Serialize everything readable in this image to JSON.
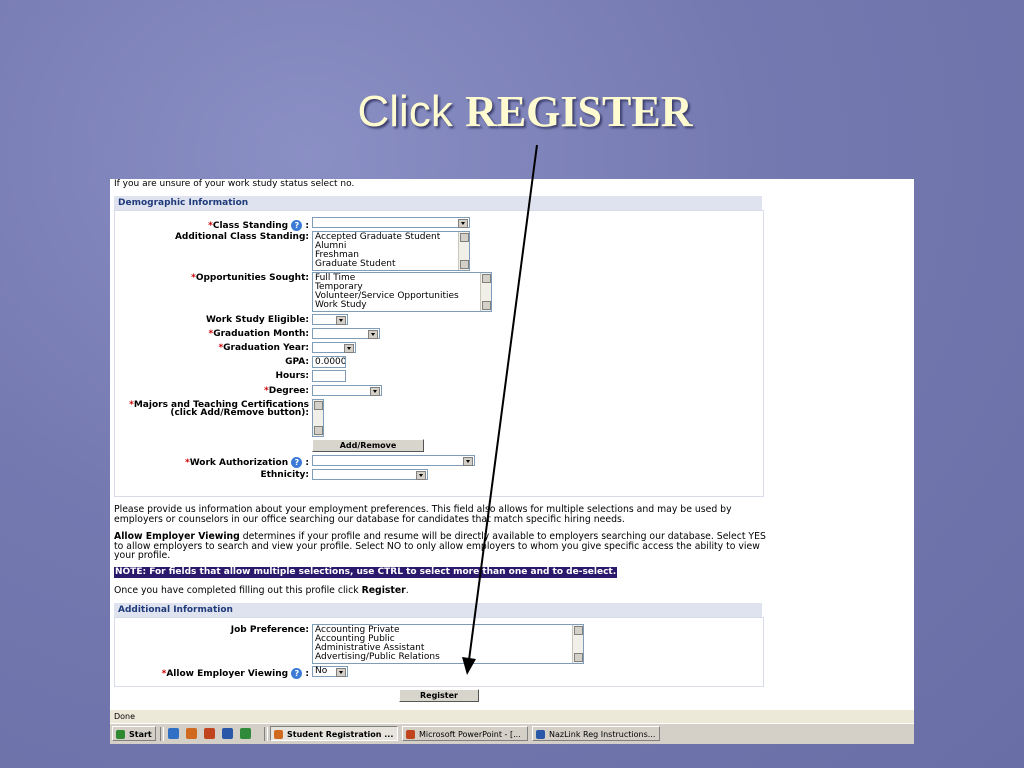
{
  "slide": {
    "title_plain": "Click",
    "title_bold": "REGISTER"
  },
  "form": {
    "intro_text": "If you are unsure of your work study status select no.",
    "demographic_header": "Demographic Information",
    "class_standing_label": "Class Standing",
    "class_standing_value": "",
    "additional_class_standing_label": "Additional Class Standing:",
    "additional_class_standing_options": [
      "Accepted Graduate Student",
      "Alumni",
      "Freshman",
      "Graduate Student"
    ],
    "opportunities_label": "Opportunities Sought:",
    "opportunities_options": [
      "Full Time",
      "Temporary",
      "Volunteer/Service Opportunities",
      "Work Study"
    ],
    "work_study_label": "Work Study Eligible:",
    "work_study_value": "",
    "grad_month_label": "Graduation Month:",
    "grad_month_value": "",
    "grad_year_label": "Graduation Year:",
    "grad_year_value": "",
    "gpa_label": "GPA:",
    "gpa_value": "0.0000",
    "hours_label": "Hours:",
    "hours_value": "",
    "degree_label": "Degree:",
    "degree_value": "",
    "majors_label_1": "Majors and Teaching Certifications",
    "majors_label_2": "(click Add/Remove button):",
    "add_remove_label": "Add/Remove",
    "work_auth_label": "Work Authorization",
    "work_auth_value": "",
    "ethnicity_label": "Ethnicity:",
    "ethnicity_value": "",
    "para1": "Please provide us information about your employment preferences. This field also allows for multiple selections and may be used by employers or counselors in our office searching our database for candidates that match specific hiring needs.",
    "para2_bold": "Allow Employer Viewing",
    "para2_rest": " determines if your profile and resume will be directly available to employers searching our database. Select YES to allow employers to search and view your profile. Select NO to only allow employers to whom you give specific access the ability to view your profile.",
    "note": "NOTE: For fields that allow multiple selections, use CTRL to select more than one and to de-select.",
    "once_text_pre": "Once you have completed filling out this profile click ",
    "once_text_bold": "Register",
    "once_text_post": ".",
    "additional_header": "Additional Information",
    "job_pref_label": "Job Preference:",
    "job_pref_options": [
      "Accounting Private",
      "Accounting Public",
      "Administrative Assistant",
      "Advertising/Public Relations"
    ],
    "allow_viewing_label": "Allow Employer Viewing",
    "allow_viewing_value": "No",
    "register_label": "Register",
    "required_mark": "*",
    "help_glyph": "?"
  },
  "status_bar": {
    "text": "Done"
  },
  "taskbar": {
    "start_label": "Start",
    "buttons": [
      "Student Registration ...",
      "Microsoft PowerPoint - [...",
      "NazLink Reg Instructions..."
    ]
  },
  "colors": {
    "slide_bg": "#7479b0",
    "title_text": "#fffbd0",
    "section_header_text": "#1f3b7a",
    "note_bg": "#2b1a6b",
    "required": "#cc0000"
  }
}
